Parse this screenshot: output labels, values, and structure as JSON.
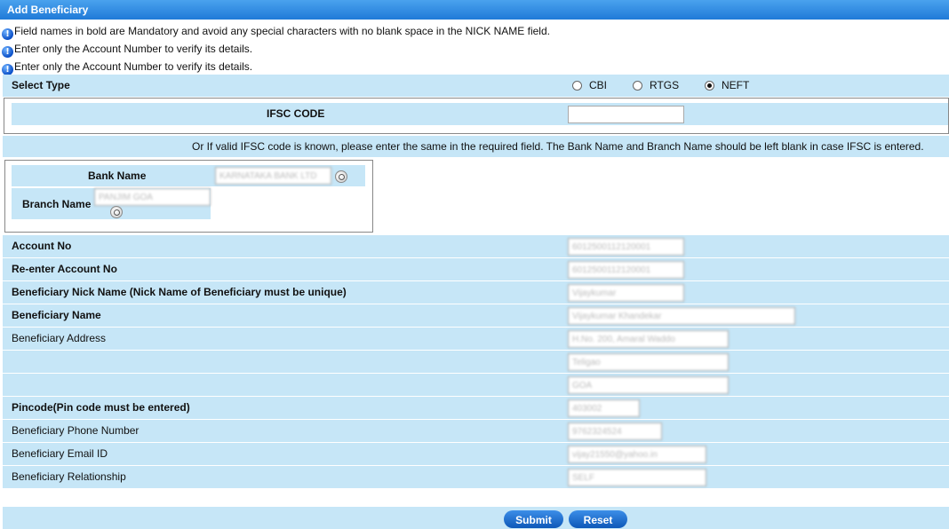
{
  "header": {
    "title": "Add Beneficiary"
  },
  "notes": [
    "Field names in bold are Mandatory and avoid any special characters with no blank space in the NICK NAME field.",
    "Enter only the Account Number to verify its details.",
    "Enter only the Account Number to verify its details."
  ],
  "select_type": {
    "label": "Select Type",
    "options": [
      "CBI",
      "RTGS",
      "NEFT"
    ],
    "selected": "NEFT"
  },
  "ifsc": {
    "label": "IFSC CODE",
    "value": ""
  },
  "ifsc_note": "Or  If valid IFSC code is known, please enter the same in the required field. The Bank Name and Branch Name should be left blank in case IFSC is entered.",
  "bank": {
    "label": "Bank Name",
    "value": "KARNATAKA BANK LTD"
  },
  "branch": {
    "label": "Branch Name",
    "value": "PANJIM GOA"
  },
  "fields": {
    "account_no": {
      "label": "Account No",
      "value": "6012500112120001"
    },
    "reenter_account_no": {
      "label": "Re-enter Account No",
      "value": "6012500112120001"
    },
    "nick_name": {
      "label": "Beneficiary Nick Name  (Nick Name of Beneficiary must be unique)",
      "value": "Vijaykumar"
    },
    "name": {
      "label": "Beneficiary Name",
      "value": "Vijaykumar Khandekar"
    },
    "address": {
      "label": "Beneficiary Address",
      "line1": "H.No. 200, Amaral Waddo",
      "line2": "Teligao",
      "line3": "GOA"
    },
    "pincode": {
      "label": "Pincode(Pin code must be entered)",
      "value": "403002"
    },
    "phone": {
      "label": "Beneficiary Phone Number",
      "value": "9762324524"
    },
    "email": {
      "label": "Beneficiary Email ID",
      "value": "vijay21550@yahoo.in"
    },
    "relationship": {
      "label": "Beneficiary Relationship",
      "value": "SELF"
    }
  },
  "buttons": {
    "submit": "Submit",
    "reset": "Reset"
  }
}
